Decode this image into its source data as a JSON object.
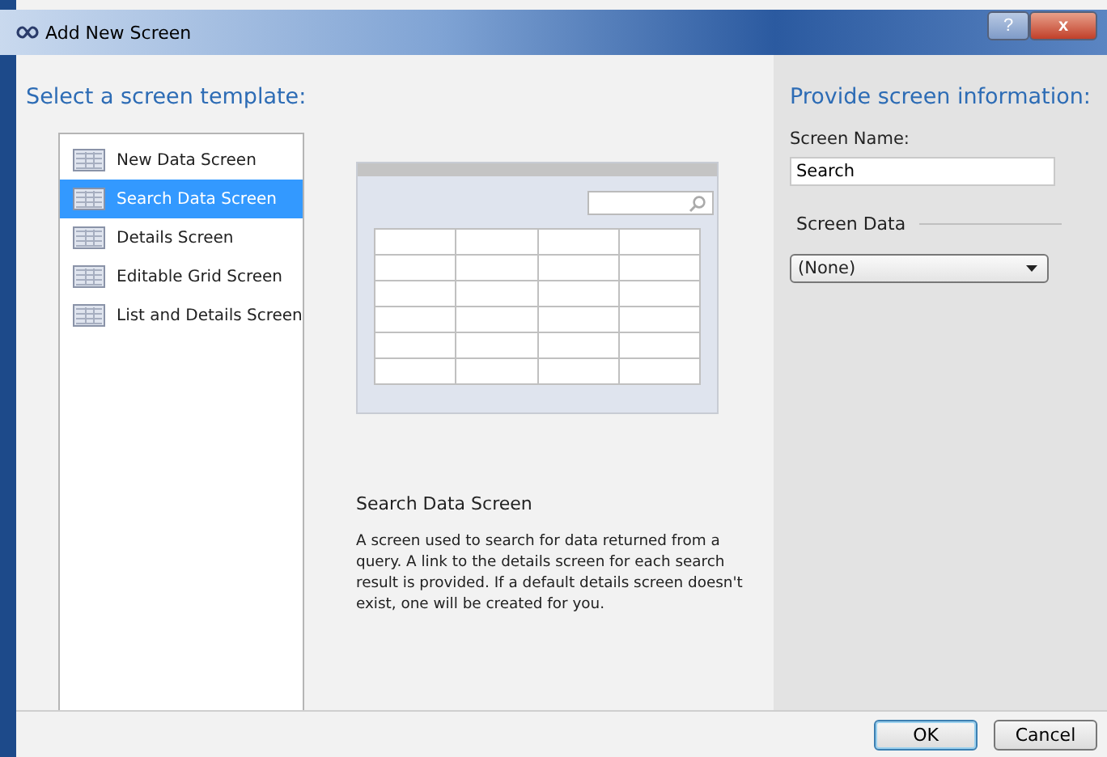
{
  "window": {
    "title": "Add New Screen",
    "buttons": [
      "?",
      "x"
    ]
  },
  "templates": {
    "heading": "Select a screen template:",
    "items": [
      {
        "label": "New Data Screen",
        "selected": false
      },
      {
        "label": "Search Data Screen",
        "selected": true
      },
      {
        "label": "Details Screen",
        "selected": false
      },
      {
        "label": "Editable Grid Screen",
        "selected": false
      },
      {
        "label": "List and Details Screen",
        "selected": false
      }
    ]
  },
  "description": {
    "title": "Search Data Screen",
    "text": "A screen used to search for data returned from a query.  A link to the details screen for each search result is provided.  If a default details screen doesn't exist, one will be created for you."
  },
  "info": {
    "heading": "Provide screen information:",
    "name_label": "Screen Name:",
    "name_value": "Search",
    "data_label": "Screen Data",
    "data_value": "(None)"
  },
  "buttons": [
    "OK",
    "Cancel"
  ]
}
